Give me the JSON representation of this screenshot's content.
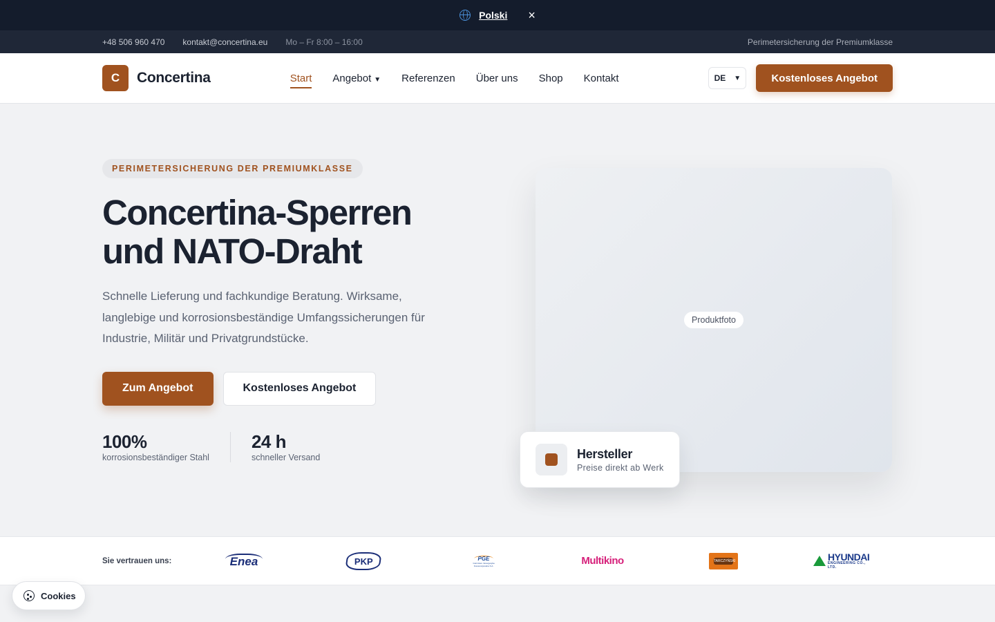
{
  "language_banner": {
    "language_label": "Polski",
    "close_glyph": "×",
    "globe_icon": "globe-icon"
  },
  "info_bar": {
    "phone": "+48 506 960 470",
    "email": "kontakt@concertina.eu",
    "hours": "Mo – Fr 8:00 – 16:00",
    "tagline": "Perimetersicherung der Premiumklasse"
  },
  "header": {
    "logo_letter": "C",
    "logo_text": "Concertina",
    "nav": [
      {
        "label": "Start",
        "active": true
      },
      {
        "label": "Angebot",
        "dropdown": true
      },
      {
        "label": "Referenzen"
      },
      {
        "label": "Über uns"
      },
      {
        "label": "Shop"
      },
      {
        "label": "Kontakt"
      }
    ],
    "language_select": "DE",
    "cta_label": "Kostenloses Angebot"
  },
  "hero": {
    "badge": "PERIMETERSICHERUNG DER PREMIUMKLASSE",
    "title_line1": "Concertina-Sperren",
    "title_line2": "und NATO-Draht",
    "subtitle": "Schnelle Lieferung und fachkundige Beratung. Wirksame, langlebige und korrosionsbeständige Umfangssicherungen für Industrie, Militär und Privatgrundstücke.",
    "primary_button": "Zum Angebot",
    "secondary_button": "Kostenloses Angebot",
    "stats": [
      {
        "value": "100%",
        "label": "korrosionsbeständiger Stahl"
      },
      {
        "value": "24 h",
        "label": "schneller Versand"
      }
    ],
    "photo_placeholder": "Produktfoto",
    "card": {
      "title": "Hersteller",
      "subtitle": "Preise direkt ab Werk"
    }
  },
  "trust": {
    "label": "Sie vertrauen uns:",
    "brands": {
      "enea": "Enea",
      "pkp": "PKP",
      "pge": "PGE",
      "pge_sub": "Górnictwo i Energetyka Konwencjonalna S.A.",
      "multikino": "Multikino",
      "tarczynski": "TARCZYŃSKI",
      "hyundai": "HYUNDAI",
      "hyundai_sub": "ENGINEERING CO., LTD."
    }
  },
  "cookies": {
    "label": "Cookies"
  },
  "colors": {
    "accent": "#a0521f",
    "dark": "#141c2c",
    "info_bar": "#1f2737",
    "hero_bg": "#f1f2f4"
  }
}
